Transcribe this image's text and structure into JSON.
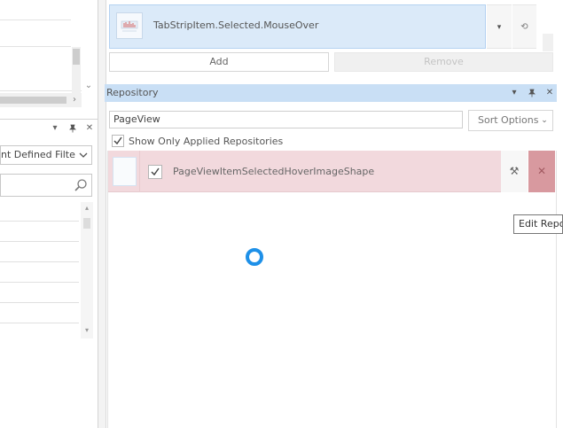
{
  "left_panel": {
    "filter_combo_text": "nt Defined Filter",
    "icons": {
      "dropdown": "▾",
      "pin": "📌",
      "close": "✕",
      "scroll_right": "›",
      "scroll_down": "⌄",
      "scroll_up": "▴",
      "grid_scroll_down": "▾",
      "search": "search-icon"
    }
  },
  "state_item": {
    "label": "TabStripItem.Selected.MouseOver",
    "dropdown_glyph": "▾",
    "reset_glyph": "⟲"
  },
  "buttons": {
    "add_label": "Add",
    "remove_label": "Remove"
  },
  "repository": {
    "title": "Repository",
    "header_icons": {
      "dropdown": "▾",
      "pin": "📌",
      "close": "✕"
    },
    "search_value": "PageView",
    "sort_label": "Sort Options",
    "sort_arrow": "⌄",
    "show_only_applied_label": "Show Only Applied Repositories",
    "show_only_applied_checked": true,
    "items": [
      {
        "label": "PageViewItemSelectedHoverImageShape",
        "checked": true
      }
    ],
    "edit_glyph": "⚒",
    "delete_glyph": "✕",
    "tooltip": "Edit Repository"
  },
  "colors": {
    "selected_state_bg": "#dbeaf9",
    "repo_header_bg": "#c9dff5",
    "repo_row_bg": "#f2d9dd",
    "delete_btn_bg": "#d8999f",
    "spinner": "#1e90e8"
  }
}
